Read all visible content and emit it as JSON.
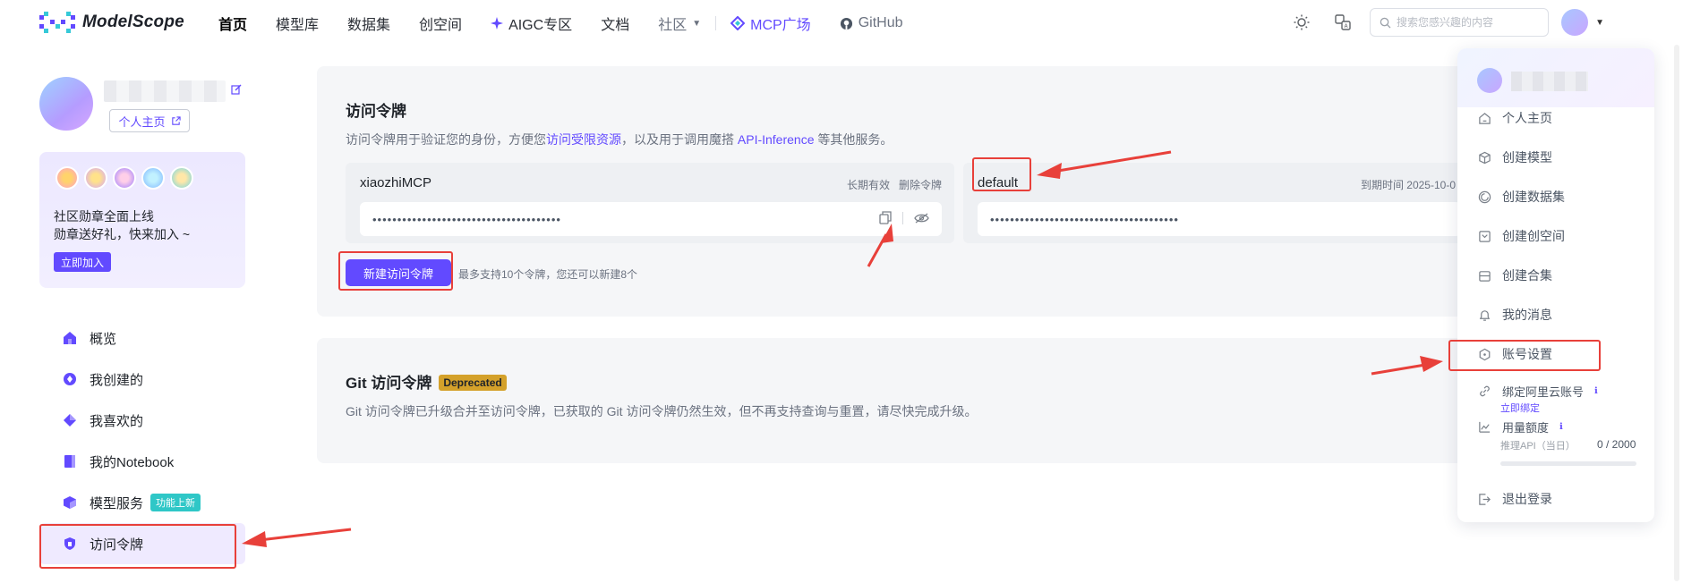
{
  "app": {
    "logo_text": "ModelScope"
  },
  "nav": {
    "items": [
      {
        "label": "首页",
        "active": true
      },
      {
        "label": "模型库"
      },
      {
        "label": "数据集"
      },
      {
        "label": "创空间"
      },
      {
        "label": "AIGC专区"
      },
      {
        "label": "文档"
      },
      {
        "label": "社区"
      },
      {
        "label": "MCP广场"
      },
      {
        "label": "GitHub"
      }
    ]
  },
  "search": {
    "placeholder": "搜索您感兴趣的内容"
  },
  "profile": {
    "home_button": "个人主页"
  },
  "badge_card": {
    "line1": "社区勋章全面上线",
    "line2": "勋章送好礼，快来加入 ~",
    "join_button": "立即加入"
  },
  "side_menu": {
    "items": [
      {
        "label": "概览"
      },
      {
        "label": "我创建的"
      },
      {
        "label": "我喜欢的"
      },
      {
        "label": "我的Notebook"
      },
      {
        "label": "模型服务",
        "tag": "功能上新"
      },
      {
        "label": "访问令牌",
        "active": true
      }
    ]
  },
  "tokens_panel": {
    "title": "访问令牌",
    "desc_pre": "访问令牌用于验证您的身份，方便您",
    "desc_link1": "访问受限资源",
    "desc_mid": "，以及用于调用魔搭 ",
    "desc_link2": "API-Inference",
    "desc_post": " 等其他服务。",
    "tokens": [
      {
        "name": "xiaozhiMCP",
        "validity": "长期有效",
        "delete": "删除令牌",
        "masked": "••••••••••••••••••••••••••••••••••••••"
      },
      {
        "name": "default",
        "expiry": "到期时间 2025-10-0",
        "masked": "••••••••••••••••••••••••••••••••••••••"
      }
    ],
    "new_button": "新建访问令牌",
    "limit_text": "最多支持10个令牌，您还可以新建8个"
  },
  "git_panel": {
    "title": "Git 访问令牌",
    "deprecated": "Deprecated",
    "desc": "Git 访问令牌已升级合并至访问令牌，已获取的 Git 访问令牌仍然生效，但不再支持查询与重置，请尽快完成升级。"
  },
  "dropdown": {
    "items": [
      {
        "label": "个人主页",
        "icon": "home-icon"
      },
      {
        "label": "创建模型",
        "icon": "cube-icon"
      },
      {
        "label": "创建数据集",
        "icon": "dataset-icon"
      },
      {
        "label": "创建创空间",
        "icon": "studio-icon"
      },
      {
        "label": "创建合集",
        "icon": "collection-icon"
      },
      {
        "label": "我的消息",
        "icon": "bell-icon"
      },
      {
        "label": "账号设置",
        "icon": "settings-icon"
      }
    ],
    "aliyun": {
      "label": "绑定阿里云账号",
      "link": "立即绑定"
    },
    "usage": {
      "label": "用量额度",
      "sub": "推理API（当日）",
      "value": "0 / 2000"
    },
    "logout": "退出登录"
  },
  "colors": {
    "brand": "#624aff",
    "annotation": "#e8403a"
  }
}
